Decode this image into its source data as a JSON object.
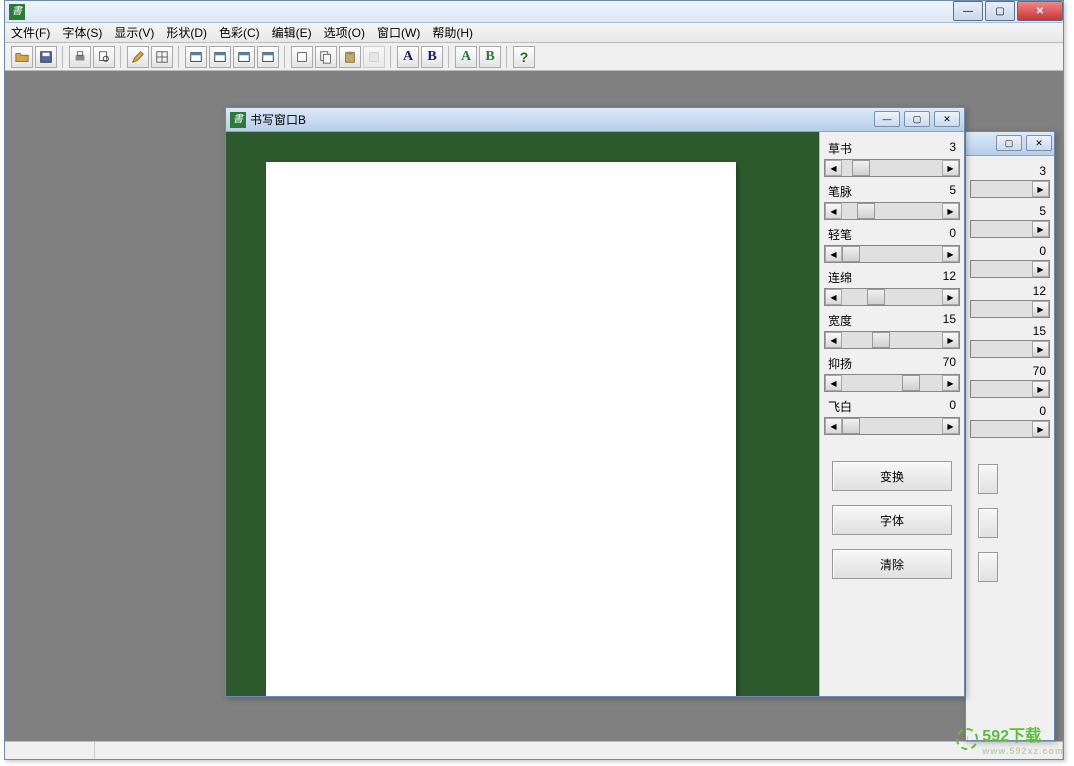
{
  "app_title": "",
  "menu": {
    "file": "文件(F)",
    "font": "字体(S)",
    "view": "显示(V)",
    "shape": "形状(D)",
    "color": "色彩(C)",
    "edit": "编辑(E)",
    "option": "选项(O)",
    "window": "窗口(W)",
    "help": "帮助(H)"
  },
  "toolbar": {
    "letter_A": "A",
    "letter_B": "B",
    "help_q": "?"
  },
  "child": {
    "title": "书写窗口B"
  },
  "sliders": [
    {
      "label": "草书",
      "value": 3,
      "pos": 10
    },
    {
      "label": "笔脉",
      "value": 5,
      "pos": 15
    },
    {
      "label": "轻笔",
      "value": 0,
      "pos": 0
    },
    {
      "label": "连绵",
      "value": 12,
      "pos": 25
    },
    {
      "label": "宽度",
      "value": 15,
      "pos": 30
    },
    {
      "label": "抑扬",
      "value": 70,
      "pos": 60
    },
    {
      "label": "飞白",
      "value": 0,
      "pos": 0
    }
  ],
  "buttons": {
    "transform": "变换",
    "font": "字体",
    "clear": "清除"
  },
  "watermark": {
    "text": "592下载",
    "sub": "www.592xz.com",
    "arrow": "↓"
  }
}
